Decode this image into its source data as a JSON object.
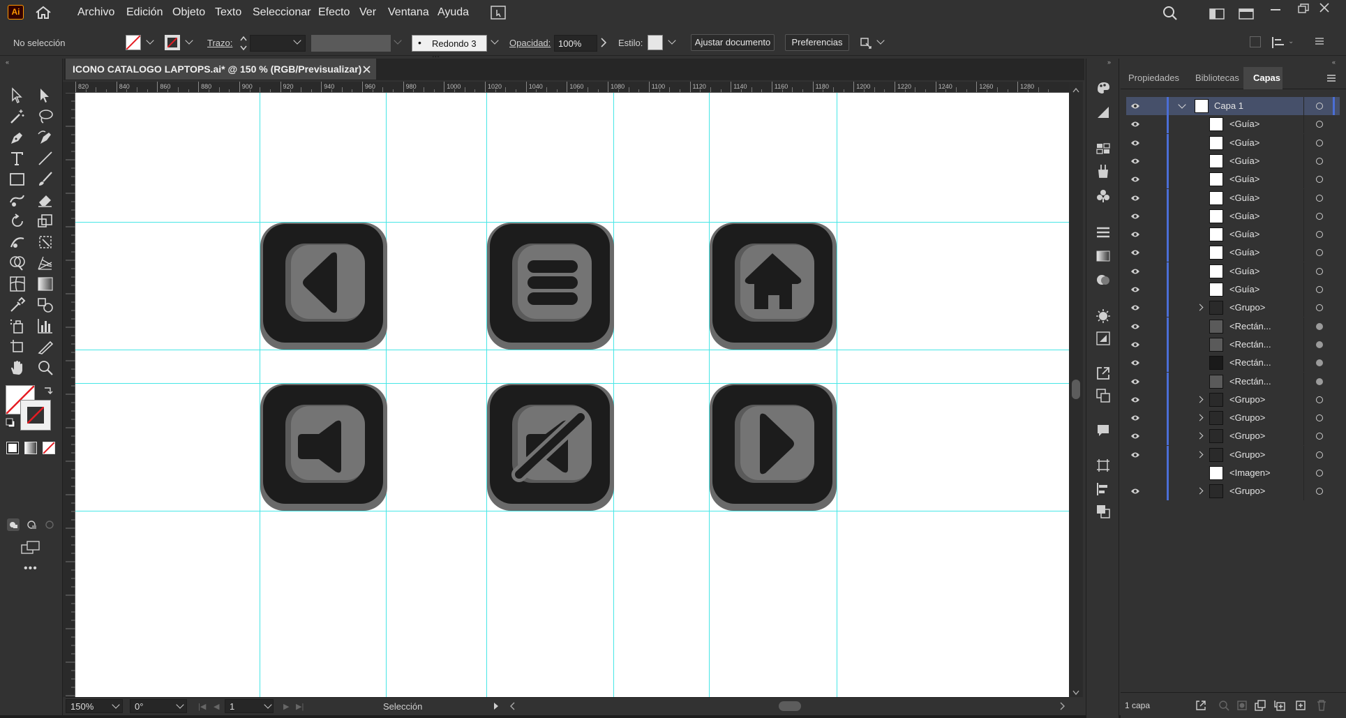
{
  "app": {
    "logo": "Ai",
    "brand_color": "#330000",
    "brand_text_color": "#ff9a00"
  },
  "menu": [
    "Archivo",
    "Edición",
    "Objeto",
    "Texto",
    "Seleccionar",
    "Efecto",
    "Ver",
    "Ventana",
    "Ayuda"
  ],
  "control_bar": {
    "selection_status": "No selección",
    "stroke_label": "Trazo:",
    "brush_label": "Redondo 3 ...",
    "opacity_label": "Opacidad:",
    "opacity_value": "100%",
    "style_label": "Estilo:",
    "fit_document_button": "Ajustar documento",
    "preferences_button": "Preferencias"
  },
  "document": {
    "tab_title": "ICONO CATALOGO LAPTOPS.ai* @ 150 % (RGB/Previsualizar)",
    "ruler_ticks": [
      "820",
      "840",
      "860",
      "880",
      "900",
      "920",
      "940",
      "960",
      "980",
      "1000",
      "1020",
      "1040",
      "1060",
      "1080",
      "1100",
      "1120",
      "1140",
      "1160",
      "1180",
      "1200",
      "1220",
      "1240",
      "1260",
      "1280"
    ],
    "canvas_icons": [
      "arrow-left",
      "menu",
      "home",
      "speaker",
      "mute",
      "arrow-right"
    ],
    "guide_color": "#46e6e6"
  },
  "status_bar": {
    "zoom": "150%",
    "rotation": "0°",
    "artboard_number": "1",
    "tool_status": "Selección"
  },
  "panel": {
    "tabs": [
      "Propiedades",
      "Bibliotecas",
      "Capas"
    ],
    "active_tab": "Capas",
    "layers": [
      {
        "name": "Capa 1",
        "type": "layer",
        "visible": true
      },
      {
        "name": "<Guía>",
        "type": "guide",
        "visible": true
      },
      {
        "name": "<Guía>",
        "type": "guide",
        "visible": true
      },
      {
        "name": "<Guía>",
        "type": "guide",
        "visible": true
      },
      {
        "name": "<Guía>",
        "type": "guide",
        "visible": true
      },
      {
        "name": "<Guía>",
        "type": "guide",
        "visible": true
      },
      {
        "name": "<Guía>",
        "type": "guide",
        "visible": true
      },
      {
        "name": "<Guía>",
        "type": "guide",
        "visible": true
      },
      {
        "name": "<Guía>",
        "type": "guide",
        "visible": true
      },
      {
        "name": "<Guía>",
        "type": "guide",
        "visible": true
      },
      {
        "name": "<Guía>",
        "type": "guide",
        "visible": true
      },
      {
        "name": "<Grupo>",
        "type": "group",
        "visible": true
      },
      {
        "name": "<Rectán...",
        "type": "rect",
        "visible": true
      },
      {
        "name": "<Rectán...",
        "type": "rect",
        "visible": true
      },
      {
        "name": "<Rectán...",
        "type": "rect",
        "visible": true
      },
      {
        "name": "<Rectán...",
        "type": "rect",
        "visible": true
      },
      {
        "name": "<Grupo>",
        "type": "group",
        "visible": true
      },
      {
        "name": "<Grupo>",
        "type": "group",
        "visible": true
      },
      {
        "name": "<Grupo>",
        "type": "group",
        "visible": true
      },
      {
        "name": "<Grupo>",
        "type": "group",
        "visible": true
      },
      {
        "name": "<Imagen>",
        "type": "image",
        "visible": false
      },
      {
        "name": "<Grupo>",
        "type": "group",
        "visible": true
      }
    ],
    "footer_count": "1 capa"
  }
}
